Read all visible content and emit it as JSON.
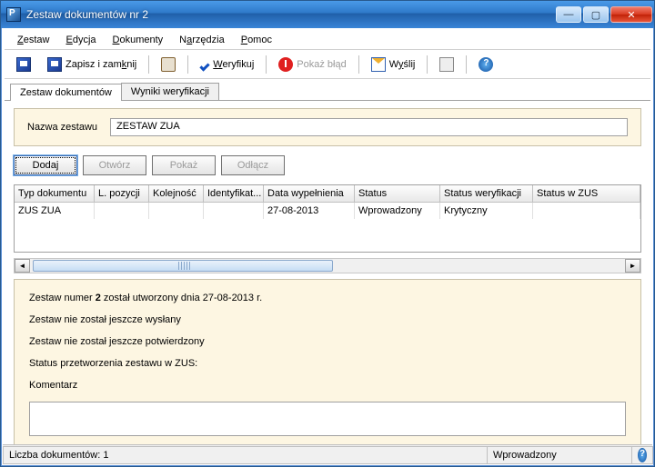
{
  "window": {
    "title": "Zestaw dokumentów nr 2"
  },
  "menu": {
    "zestaw": "Zestaw",
    "edycja": "Edycja",
    "dokumenty": "Dokumenty",
    "narzedzia": "Narzędzia",
    "pomoc": "Pomoc"
  },
  "toolbar": {
    "zapisz_i_zamknij": "Zapisz i zamknij",
    "weryfikuj": "Weryfikuj",
    "pokaz_blad": "Pokaż błąd",
    "wyslij": "Wyślij"
  },
  "tabs": {
    "zestaw_dokumentow": "Zestaw dokumentów",
    "wyniki_weryfikacji": "Wyniki weryfikacji"
  },
  "name_section": {
    "label": "Nazwa zestawu",
    "value": "ZESTAW ZUA"
  },
  "buttons": {
    "dodaj": "Dodaj",
    "otworz": "Otwórz",
    "pokaz": "Pokaż",
    "odlacz": "Odłącz"
  },
  "grid": {
    "headers": {
      "typ": "Typ dokumentu",
      "lp": "L. pozycji",
      "kol": "Kolejność",
      "ident": "Identyfikat...",
      "data": "Data wypełnienia",
      "status": "Status",
      "statwer": "Status weryfikacji",
      "statzus": "Status w ZUS"
    },
    "rows": [
      {
        "typ": "ZUS ZUA",
        "lp": "",
        "kol": "",
        "ident": "",
        "data": "27-08-2013",
        "status": "Wprowadzony",
        "statwer": "Krytyczny",
        "statzus": ""
      }
    ]
  },
  "info": {
    "line1_pre": "Zestaw numer ",
    "line1_num": "2",
    "line1_post": " został utworzony dnia 27-08-2013 r.",
    "line2": "Zestaw nie został jeszcze wysłany",
    "line3": "Zestaw nie został jeszcze potwierdzony",
    "line4": "Status przetworzenia zestawu w ZUS:",
    "komentarz_label": "Komentarz",
    "komentarz_value": ""
  },
  "statusbar": {
    "left": "Liczba dokumentów: 1",
    "right": "Wprowadzony"
  }
}
